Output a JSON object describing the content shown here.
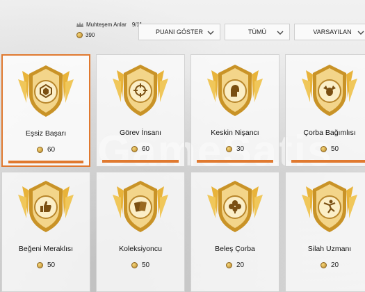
{
  "header": {
    "title": "Muhteşem Anlar",
    "count": "9/11",
    "points": "390",
    "icons": {
      "title": "crown-icon",
      "points": "coin-icon"
    }
  },
  "filters": {
    "show_points": "PUANI GÖSTER",
    "category": "TÜMÜ",
    "sort": "VARSAYILAN"
  },
  "watermark": "GameSatis",
  "colors": {
    "accent": "#e0792f",
    "gold": "#e8b33a"
  },
  "cards": [
    {
      "name": "Eşsiz Başarı",
      "points": "60",
      "icon": "crowned-emblem-icon",
      "progress": 1.0
    },
    {
      "name": "Görev İnsanı",
      "points": "60",
      "icon": "crosshair-icon",
      "progress": 1.0
    },
    {
      "name": "Keskin Nişancı",
      "points": "30",
      "icon": "soldier-helmet-icon",
      "progress": 1.0
    },
    {
      "name": "Çorba Bağımlısı",
      "points": "50",
      "icon": "winged-chicken-icon",
      "progress": 1.0
    },
    {
      "name": "Beğeni Meraklısı",
      "points": "50",
      "icon": "thumbs-up-icon"
    },
    {
      "name": "Koleksiyoncu",
      "points": "50",
      "icon": "playing-cards-icon"
    },
    {
      "name": "Beleş Çorba",
      "points": "20",
      "icon": "clover-icon"
    },
    {
      "name": "Silah Uzmanı",
      "points": "20",
      "icon": "jumping-soldier-icon"
    }
  ]
}
